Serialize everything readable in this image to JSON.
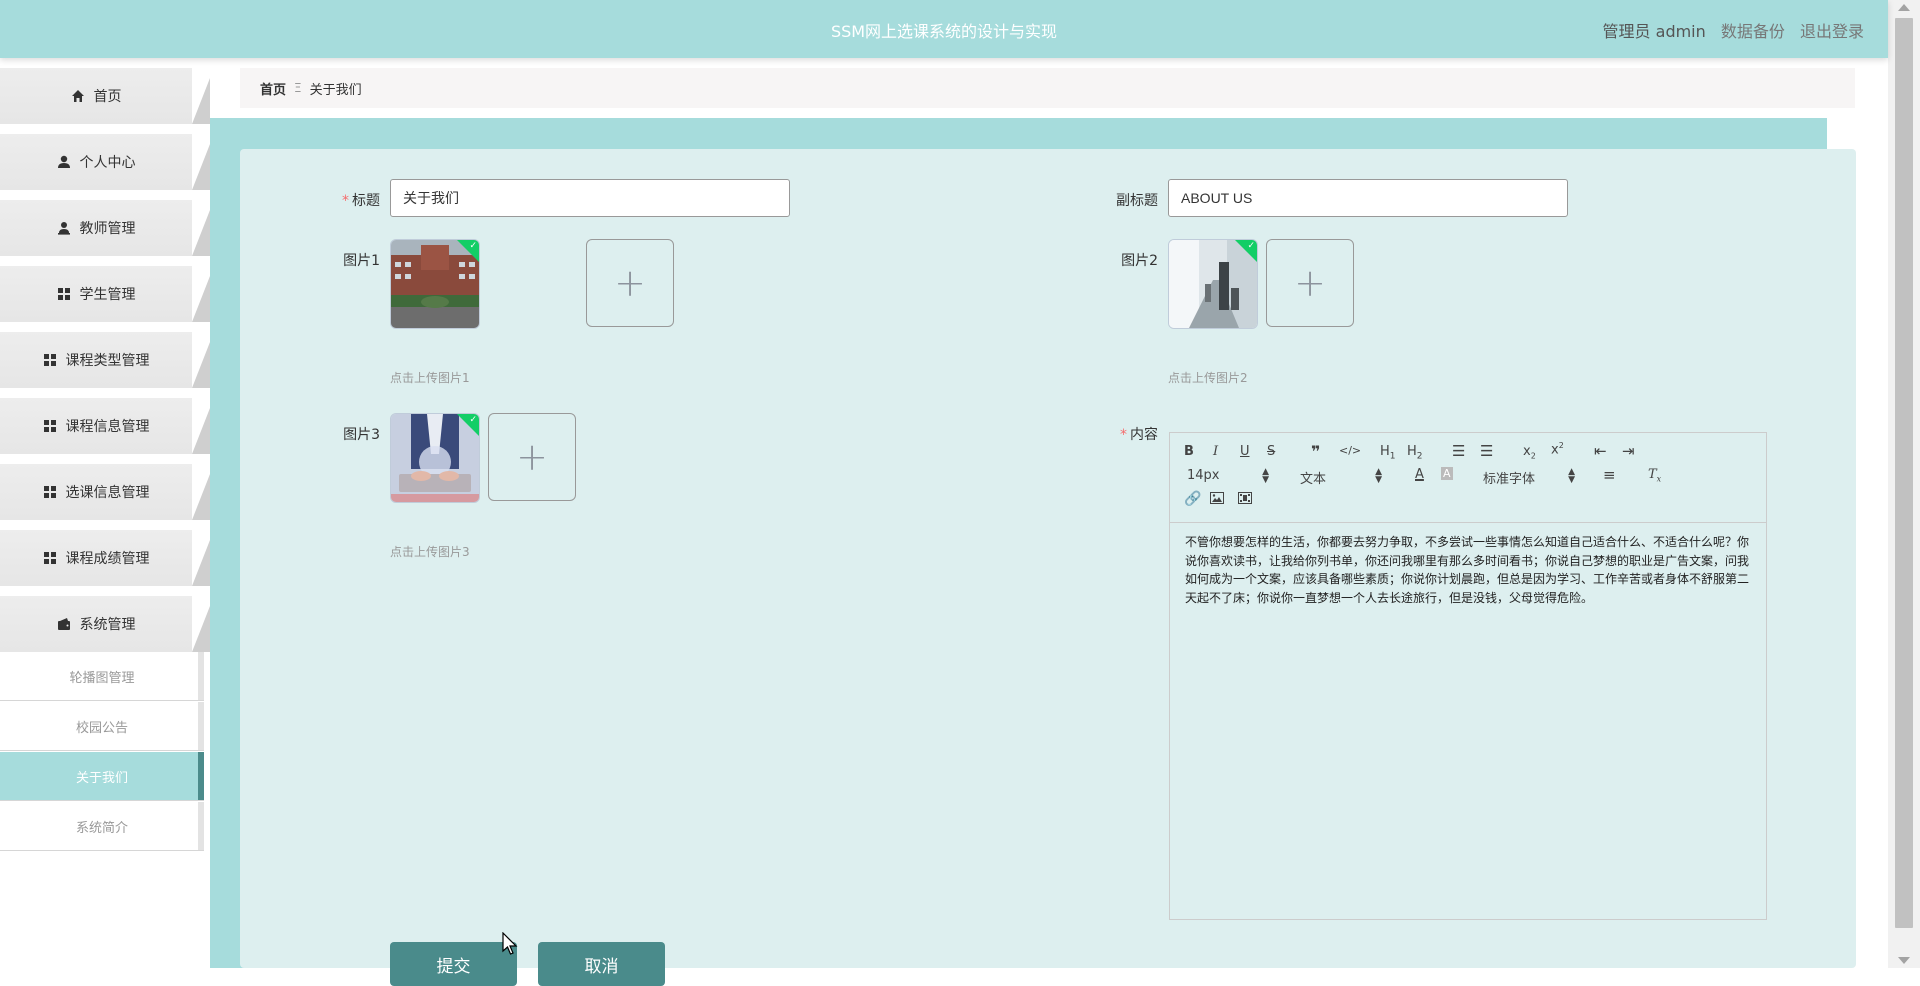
{
  "app_title": "SSM网上选课系统的设计与实现",
  "header": {
    "user": "管理员 admin",
    "backup": "数据备份",
    "logout": "退出登录"
  },
  "sidebar": {
    "items": [
      {
        "label": "首页",
        "icon": "home-icon"
      },
      {
        "label": "个人中心",
        "icon": "user-icon"
      },
      {
        "label": "教师管理",
        "icon": "teacher-icon"
      },
      {
        "label": "学生管理",
        "icon": "grid-icon"
      },
      {
        "label": "课程类型管理",
        "icon": "grid-icon"
      },
      {
        "label": "课程信息管理",
        "icon": "grid-icon"
      },
      {
        "label": "选课信息管理",
        "icon": "grid-icon"
      },
      {
        "label": "课程成绩管理",
        "icon": "grid-icon"
      },
      {
        "label": "系统管理",
        "icon": "wallet-icon"
      }
    ],
    "submenu": [
      "轮播图管理",
      "校园公告",
      "关于我们",
      "系统简介"
    ],
    "active_submenu": "关于我们"
  },
  "breadcrumb": {
    "home": "首页",
    "sep": "Ξ",
    "current": "关于我们"
  },
  "form": {
    "title_label": "标题",
    "title_value": "关于我们",
    "subtitle_label": "副标题",
    "subtitle_value": "ABOUT US",
    "pic1_label": "图片1",
    "pic1_tip": "点击上传图片1",
    "pic2_label": "图片2",
    "pic2_tip": "点击上传图片2",
    "pic3_label": "图片3",
    "pic3_tip": "点击上传图片3",
    "content_label": "内容",
    "submit": "提交",
    "cancel": "取消"
  },
  "editor": {
    "font_size": "14px",
    "header_select": "文本",
    "font_family": "标准字体",
    "content": "不管你想要怎样的生活，你都要去努力争取，不多尝试一些事情怎么知道自己适合什么、不适合什么呢？你说你喜欢读书，让我给你列书单，你还问我哪里有那么多时间看书；你说自己梦想的职业是广告文案，问我如何成为一个文案，应该具备哪些素质；你说你计划晨跑，但总是因为学习、工作辛苦或者身体不舒服第二天起不了床；你说你一直梦想一个人去长途旅行，但是没钱，父母觉得危险。"
  },
  "colors": {
    "theme": "#a6dcdc",
    "button": "#4a8b8b",
    "panel": "#ddefef",
    "required": "#f56c6c"
  }
}
